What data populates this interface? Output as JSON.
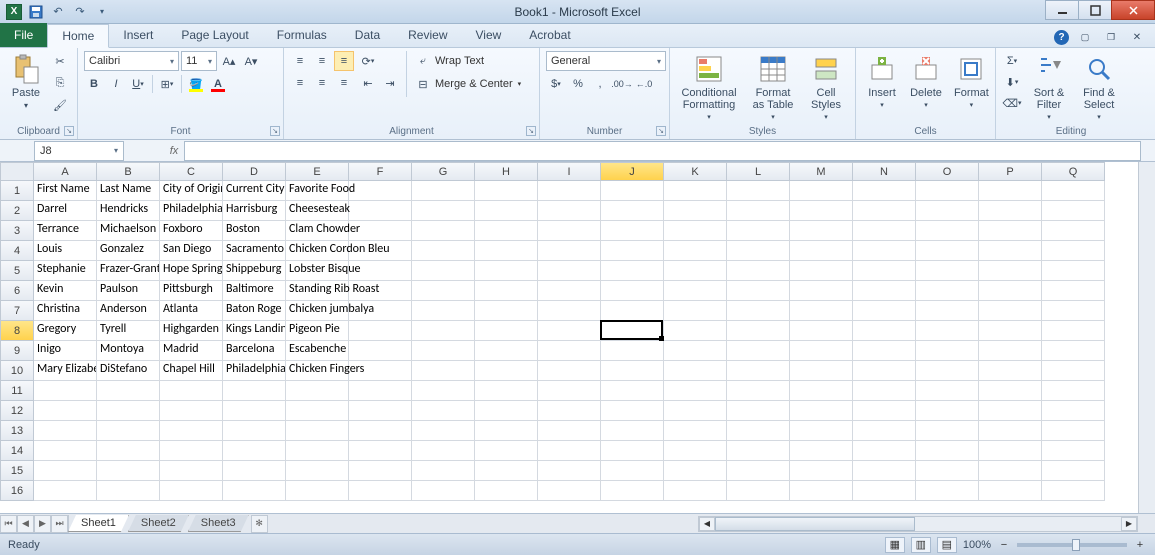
{
  "app": {
    "title": "Book1 - Microsoft Excel"
  },
  "qat": {
    "save": "💾",
    "undo": "↶",
    "redo": "↷"
  },
  "tabs": {
    "file": "File",
    "items": [
      "Home",
      "Insert",
      "Page Layout",
      "Formulas",
      "Data",
      "Review",
      "View",
      "Acrobat"
    ],
    "active": "Home"
  },
  "ribbon": {
    "clipboard": {
      "label": "Clipboard",
      "paste": "Paste"
    },
    "font": {
      "label": "Font",
      "name": "Calibri",
      "size": "11"
    },
    "alignment": {
      "label": "Alignment",
      "wrap": "Wrap Text",
      "merge": "Merge & Center"
    },
    "number": {
      "label": "Number",
      "format": "General"
    },
    "styles": {
      "label": "Styles",
      "cond": "Conditional Formatting",
      "fmtTable": "Format as Table",
      "cellStyles": "Cell Styles"
    },
    "cells": {
      "label": "Cells",
      "insert": "Insert",
      "delete": "Delete",
      "format": "Format"
    },
    "editing": {
      "label": "Editing",
      "sort": "Sort & Filter",
      "find": "Find & Select"
    }
  },
  "namebox": "J8",
  "columns": [
    "A",
    "B",
    "C",
    "D",
    "E",
    "F",
    "G",
    "H",
    "I",
    "J",
    "K",
    "L",
    "M",
    "N",
    "O",
    "P",
    "Q"
  ],
  "activeCol": "J",
  "activeRow": 8,
  "rows": [
    {
      "n": 1,
      "cells": [
        "First Name",
        "Last Name",
        "City of Origin",
        "Current City",
        "Favorite Food"
      ]
    },
    {
      "n": 2,
      "cells": [
        "Darrel",
        "Hendricks",
        "Philadelphia",
        "Harrisburg",
        "Cheesesteak"
      ]
    },
    {
      "n": 3,
      "cells": [
        "Terrance",
        "Michaelson",
        "Foxboro",
        "Boston",
        "Clam Chowder"
      ]
    },
    {
      "n": 4,
      "cells": [
        "Louis",
        "Gonzalez",
        "San Diego",
        "Sacramento",
        "Chicken Cordon Bleu"
      ]
    },
    {
      "n": 5,
      "cells": [
        "Stephanie",
        "Frazer-Grant",
        "Hope Springs",
        "Shippeburg",
        "Lobster Bisque"
      ]
    },
    {
      "n": 6,
      "cells": [
        "Kevin",
        "Paulson",
        "Pittsburgh",
        "Baltimore",
        "Standing Rib Roast"
      ]
    },
    {
      "n": 7,
      "cells": [
        "Christina",
        "Anderson",
        "Atlanta",
        "Baton Roge",
        "Chicken jumbalya"
      ]
    },
    {
      "n": 8,
      "cells": [
        "Gregory",
        "Tyrell",
        "Highgarden",
        "Kings Landing",
        "Pigeon Pie"
      ]
    },
    {
      "n": 9,
      "cells": [
        "Inigo",
        "Montoya",
        "Madrid",
        "Barcelona",
        "Escabenche"
      ]
    },
    {
      "n": 10,
      "cells": [
        "Mary Elizabeth",
        "DiStefano",
        "Chapel Hill",
        "Philadelphia",
        "Chicken Fingers"
      ]
    },
    {
      "n": 11,
      "cells": []
    },
    {
      "n": 12,
      "cells": []
    },
    {
      "n": 13,
      "cells": []
    },
    {
      "n": 14,
      "cells": []
    },
    {
      "n": 15,
      "cells": []
    },
    {
      "n": 16,
      "cells": []
    }
  ],
  "sheets": [
    "Sheet1",
    "Sheet2",
    "Sheet3"
  ],
  "status": {
    "ready": "Ready",
    "zoom": "100%"
  }
}
